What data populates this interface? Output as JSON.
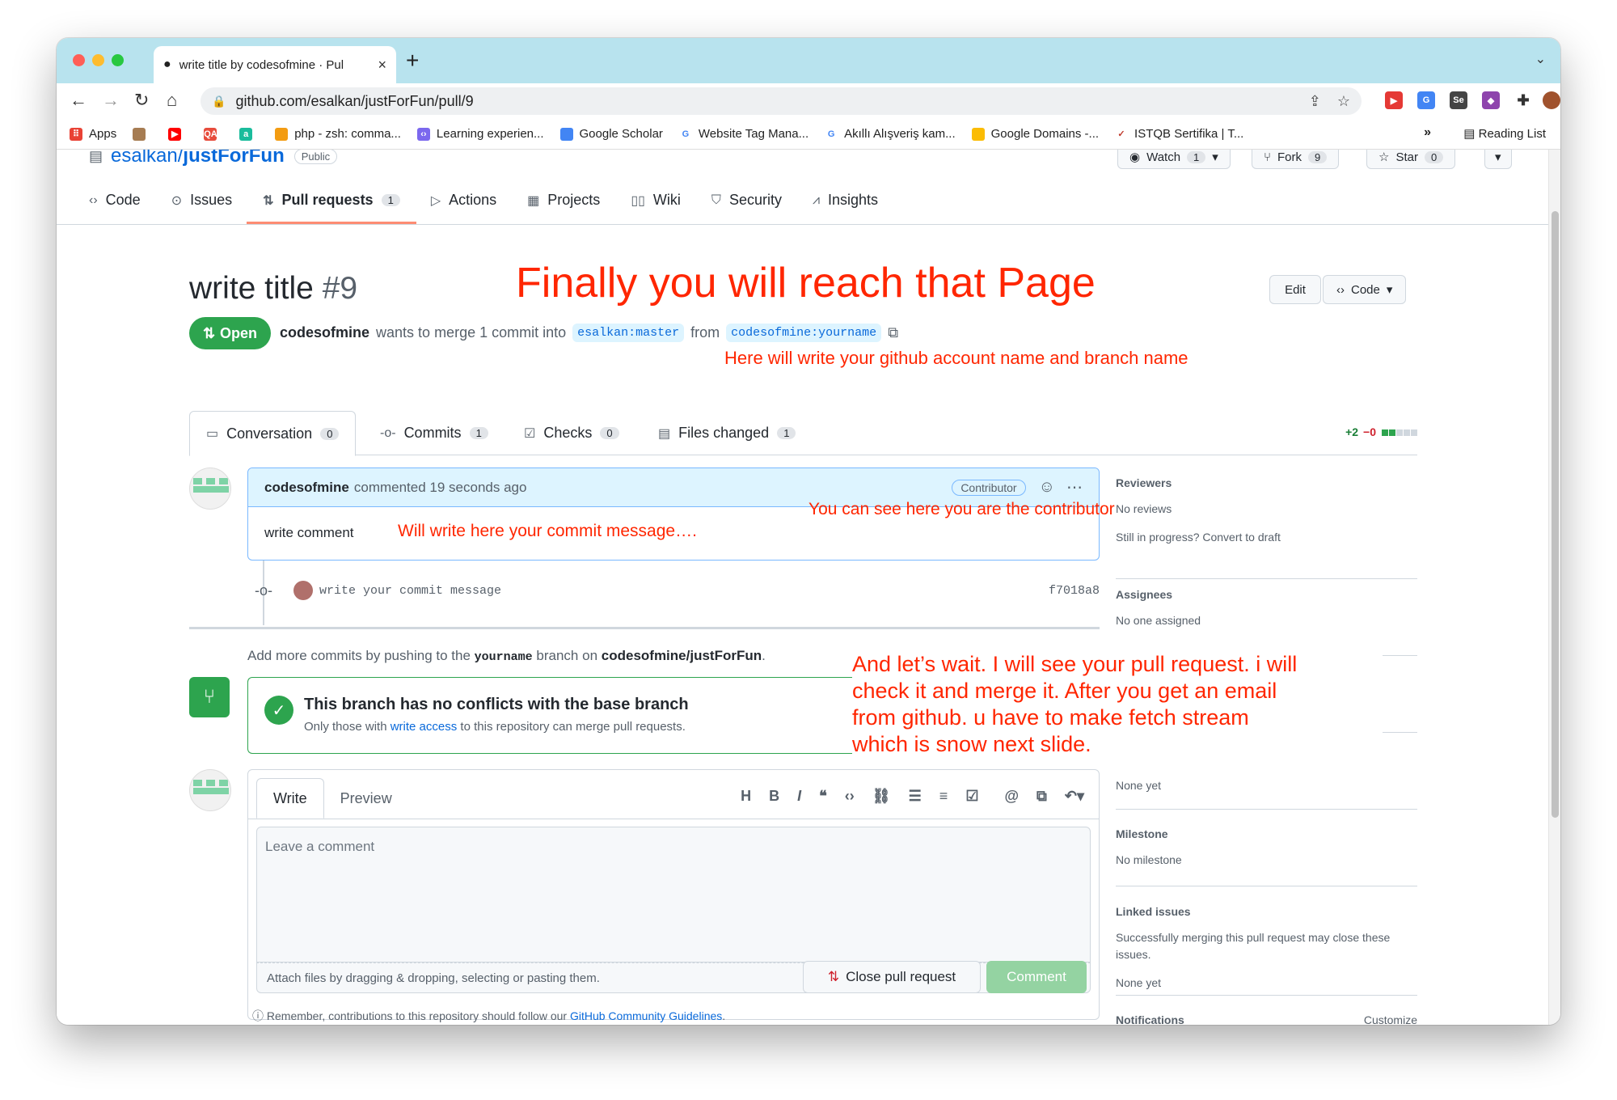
{
  "browser": {
    "tab_title": "write title by codesofmine · Pul",
    "url": "github.com/esalkan/justForFun/pull/9",
    "bookmarks": [
      "Apps",
      "php - zsh: comma...",
      "Learning experien...",
      "Google Scholar",
      "Website Tag Mana...",
      "Akıllı Alışveriş kam...",
      "Google Domains -...",
      "ISTQB Sertifika | T..."
    ],
    "bookmarks_more": "»",
    "reading_list": "Reading List"
  },
  "repo": {
    "owner": "esalkan",
    "sep": " / ",
    "name": "justForFun",
    "visibility": "Public",
    "watch_label": "Watch",
    "watch_count": "1",
    "fork_label": "Fork",
    "fork_count": "9",
    "star_label": "Star",
    "star_count": "0"
  },
  "repo_nav": {
    "code": "Code",
    "issues": "Issues",
    "pull_requests": "Pull requests",
    "pull_requests_count": "1",
    "actions": "Actions",
    "projects": "Projects",
    "wiki": "Wiki",
    "security": "Security",
    "insights": "Insights"
  },
  "pr": {
    "title": "write title",
    "number": "#9",
    "edit": "Edit",
    "code_btn": "Code",
    "state": "Open",
    "author": "codesofmine",
    "merge_text": "wants to merge 1 commit into",
    "base": "esalkan:master",
    "from": "from",
    "head": "codesofmine:yourname"
  },
  "pr_tabs": {
    "conversation": "Conversation",
    "conversation_count": "0",
    "commits": "Commits",
    "commits_count": "1",
    "checks": "Checks",
    "checks_count": "0",
    "files": "Files changed",
    "files_count": "1",
    "additions": "+2",
    "deletions": "−0"
  },
  "comment": {
    "author": "codesofmine",
    "time": "commented 19 seconds ago",
    "badge": "Contributor",
    "body": "write comment"
  },
  "commit": {
    "message": "write your commit message",
    "sha": "f7018a8"
  },
  "addmore": {
    "prefix": "Add more commits by pushing to the",
    "branch": "yourname",
    "middle": "branch on",
    "repo": "codesofmine/justForFun",
    "suffix": "."
  },
  "merge": {
    "title": "This branch has no conflicts with the base branch",
    "sub_prefix": "Only those with",
    "sub_link": "write access",
    "sub_suffix": "to this repository can merge pull requests."
  },
  "editor": {
    "write_tab": "Write",
    "preview_tab": "Preview",
    "placeholder": "Leave a comment",
    "attach": "Attach files by dragging & dropping, selecting or pasting them.",
    "close_btn": "Close pull request",
    "comment_btn": "Comment",
    "remember_prefix": "Remember, contributions to this repository should follow our",
    "remember_link": "GitHub Community Guidelines",
    "remember_suffix": "."
  },
  "sidebar": {
    "reviewers_h": "Reviewers",
    "reviewers_v": "No reviews",
    "draft": "Still in progress? Convert to draft",
    "assignees_h": "Assignees",
    "assignees_v": "No one assigned",
    "projects_v": "None yet",
    "milestone_h": "Milestone",
    "milestone_v": "No milestone",
    "linked_h": "Linked issues",
    "linked_text": "Successfully merging this pull request may close these issues.",
    "linked_v": "None yet",
    "notifications_h": "Notifications",
    "customize": "Customize"
  },
  "annotations": {
    "title": "Finally you will reach that Page",
    "branch_note": "Here will write your github account name and branch name",
    "contrib_note": "You can see here you are the contributor",
    "commit_note": "Will write here your commit message….",
    "wait_line1": "And let’s wait. I will see your pull request. i will",
    "wait_line2": "check it and merge it.  After you get an email",
    "wait_line3": "from github. u have to make fetch stream",
    "wait_line4": "which is snow next slide."
  },
  "colors": {
    "annotation": "#ff2600",
    "green": "#2da44e",
    "link": "#0969da"
  }
}
